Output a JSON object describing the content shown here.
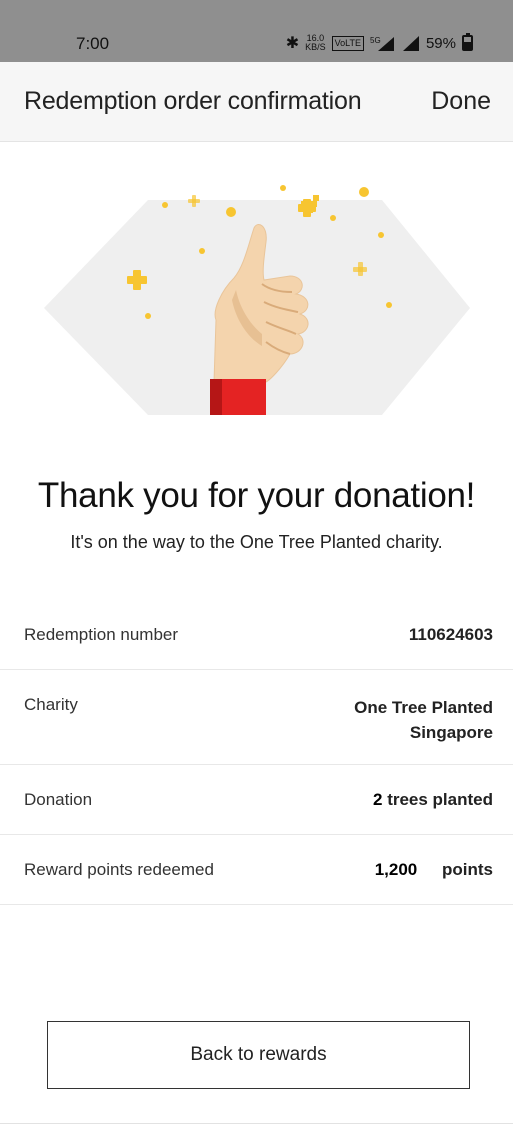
{
  "status_bar": {
    "time": "7:00",
    "speed_value": "16.0",
    "speed_unit": "KB/S",
    "volte": "VoLTE",
    "network": "5G",
    "battery": "59%"
  },
  "header": {
    "title": "Redemption order confirmation",
    "done_label": "Done"
  },
  "hero": {
    "illustration": "thumbs-up-icon",
    "accent_colors": {
      "sparkle": "#f7c531",
      "sleeve": "#e42323",
      "skin": "#f4d4ad",
      "background": "#efefef"
    }
  },
  "confirmation": {
    "title": "Thank you for your donation!",
    "subtitle": "It's on the way to the One Tree Planted charity."
  },
  "details": [
    {
      "label": "Redemption number",
      "value": "110624603"
    },
    {
      "label": "Charity",
      "value_line1": "One Tree Planted",
      "value_line2": "Singapore"
    },
    {
      "label": "Donation",
      "count": "2",
      "unit": "trees planted"
    },
    {
      "label": "Reward points redeemed",
      "count": "1,200",
      "unit": "points"
    }
  ],
  "actions": {
    "back_label": "Back to rewards"
  }
}
